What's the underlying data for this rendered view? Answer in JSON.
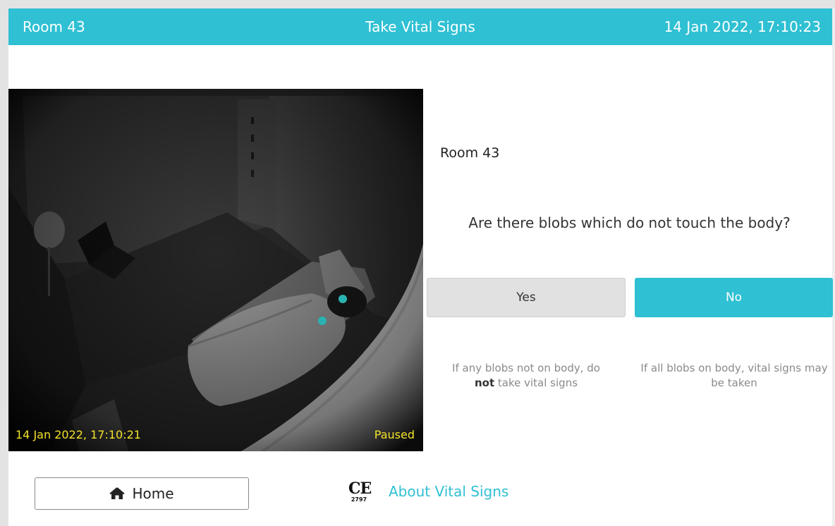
{
  "header": {
    "room": "Room 43",
    "title": "Take Vital Signs",
    "datetime": "14 Jan 2022, 17:10:23"
  },
  "video": {
    "timestamp": "14 Jan 2022, 17:10:21",
    "status": "Paused"
  },
  "panel": {
    "room": "Room 43",
    "question": "Are there blobs which do not touch the body?",
    "yes_label": "Yes",
    "no_label": "No",
    "hint_yes_before": "If any blobs not on body, do",
    "hint_yes_bold": "not",
    "hint_yes_after": " take vital signs",
    "hint_no": "If all blobs on body, vital signs may be taken"
  },
  "footer": {
    "home_label": "Home",
    "ce_number": "2797",
    "about_label": "About Vital Signs"
  },
  "colors": {
    "accent": "#2fc0d3",
    "overlay_text": "#f3e22a"
  }
}
